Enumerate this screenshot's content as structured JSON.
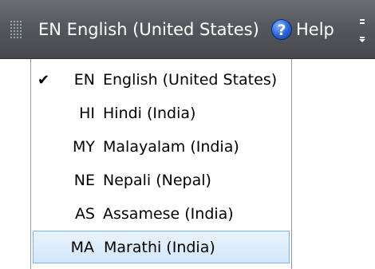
{
  "language_bar": {
    "current_code": "EN",
    "current_name": "English (United States)",
    "help_label": "Help",
    "background": "#55595d",
    "grip_icon": "grip-dots-icon",
    "help_icon": "help-question-icon",
    "options_icon": "options-chevron-icon"
  },
  "language_menu": {
    "accent_highlight": "#d2e6fa",
    "items": [
      {
        "code": "EN",
        "name": "English (United States)",
        "checked": true,
        "highlighted": false
      },
      {
        "code": "HI",
        "name": "Hindi (India)",
        "checked": false,
        "highlighted": false
      },
      {
        "code": "MY",
        "name": "Malayalam (India)",
        "checked": false,
        "highlighted": false
      },
      {
        "code": "NE",
        "name": "Nepali (Nepal)",
        "checked": false,
        "highlighted": false
      },
      {
        "code": "AS",
        "name": "Assamese (India)",
        "checked": false,
        "highlighted": false
      },
      {
        "code": "MA",
        "name": "Marathi (India)",
        "checked": false,
        "highlighted": true
      }
    ]
  }
}
